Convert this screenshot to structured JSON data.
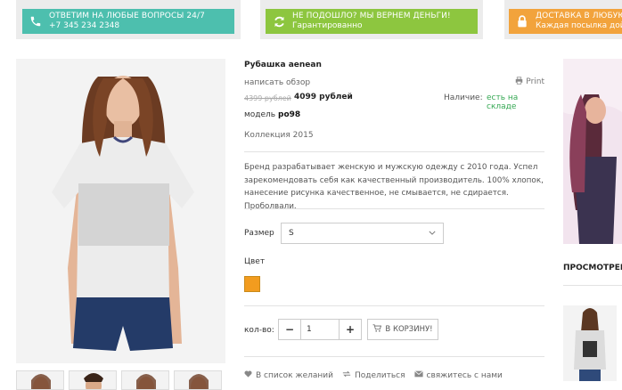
{
  "banners": [
    {
      "line1": "ОТВЕТИМ НА ЛЮБЫЕ ВОПРОСЫ 24/7",
      "line2": "+7 345 234 2348",
      "icon": "phone-icon",
      "color": "#4dbfae"
    },
    {
      "line1": "НЕ ПОДОШЛО? МЫ ВЕРНЕМ ДЕНЬГИ!",
      "line2": "Гарантированно",
      "icon": "refresh-icon",
      "color": "#8dc63f"
    },
    {
      "line1": "ДОСТАВКА В ЛЮБУЮ",
      "line2": "Каждая посылка дой",
      "icon": "lock-icon",
      "color": "#f2a33c"
    }
  ],
  "product": {
    "title": "Рубашка aenean",
    "review_link": "написать обзор",
    "print_label": "Print",
    "price_old": "4399 рублей",
    "price_new": "4099 рублей",
    "availability_label": "Наличие:",
    "availability_value": "есть на складе",
    "model_label": "модель",
    "model_value": "po98",
    "collection_label": "Коллекция",
    "collection_value": "2015",
    "description": "Бренд разрабатывает женскую и мужскую одежду с 2010 года. Успел зарекомендовать себя как качественный производитель. 100% хлопок, нанесение рисунка качественное, не смывается, не сдирается. Проболвали.",
    "size_label": "Размер",
    "size_value": "S",
    "color_label": "Цвет",
    "color_swatch": "#f29c1f",
    "qty_label": "кол-во:",
    "qty_value": "1",
    "qty_minus": "−",
    "qty_plus": "+",
    "cart_button": "В КОРЗИНУ!",
    "wishlist": "В список желаний",
    "share": "Поделиться",
    "contact": "свяжитесь с нами"
  },
  "sidebar": {
    "viewed_heading": "ПРОСМОТРЕН"
  }
}
